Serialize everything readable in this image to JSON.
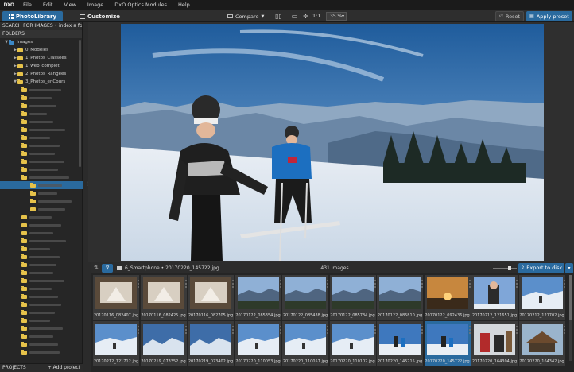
{
  "menubar": {
    "logo": "DXO",
    "items": [
      "File",
      "Edit",
      "View",
      "Image",
      "DxO Optics Modules",
      "Help"
    ]
  },
  "toolbar": {
    "photolibrary_label": "PhotoLibrary",
    "customize_label": "Customize",
    "compare_label": "Compare",
    "one_to_one": "1:1",
    "zoom_value": "35 %",
    "reset_label": "Reset",
    "apply_preset_label": "Apply preset"
  },
  "left_panel": {
    "search_label": "SEARCH FOR IMAGES • index a folder",
    "folders_header": "FOLDERS",
    "tree": [
      {
        "label": "Images",
        "indent": 1,
        "drive": true,
        "open": true
      },
      {
        "label": "0_Modeles",
        "indent": 2,
        "open": false
      },
      {
        "label": "1_Photos_Classees",
        "indent": 2,
        "open": false
      },
      {
        "label": "1_web_complet",
        "indent": 2,
        "open": false
      },
      {
        "label": "2_Photos_Rangees",
        "indent": 2,
        "open": false
      },
      {
        "label": "3_Photos_enCours",
        "indent": 2,
        "open": true
      }
    ],
    "projects_label": "PROJECTS",
    "add_project_label": "+ Add project"
  },
  "filmstrip_bar": {
    "breadcrumb": "6_Smartphone • 20170220_145722.jpg",
    "count": "431 images",
    "export_label": "Export to disk"
  },
  "filmstrip": {
    "selected_index": 17,
    "thumbnails": [
      {
        "name": "20170116_082407.jpg",
        "scene": "indoor"
      },
      {
        "name": "20170116_082425.jpg",
        "scene": "indoor"
      },
      {
        "name": "20170116_082705.jpg",
        "scene": "indoor"
      },
      {
        "name": "20170122_085354.jpg",
        "scene": "valley"
      },
      {
        "name": "20170122_085438.jpg",
        "scene": "valley"
      },
      {
        "name": "20170122_085734.jpg",
        "scene": "valley"
      },
      {
        "name": "20170122_085810.jpg",
        "scene": "valley"
      },
      {
        "name": "20170122_092436.jpg",
        "scene": "sunset"
      },
      {
        "name": "20170212_121651.jpg",
        "scene": "portrait"
      },
      {
        "name": "20170212_121702.jpg",
        "scene": "snow"
      },
      {
        "name": "20170212_121712.jpg",
        "scene": "snow"
      },
      {
        "name": "20170219_073352.jpg",
        "scene": "mountain"
      },
      {
        "name": "20170219_073402.jpg",
        "scene": "mountain"
      },
      {
        "name": "20170220_110053.jpg",
        "scene": "snow"
      },
      {
        "name": "20170220_110057.jpg",
        "scene": "snow"
      },
      {
        "name": "20170220_110102.jpg",
        "scene": "snow"
      },
      {
        "name": "20170220_145715.jpg",
        "scene": "skiers"
      },
      {
        "name": "20170220_145722.jpg",
        "scene": "skiers"
      },
      {
        "name": "20170220_164304.jpg",
        "scene": "people"
      },
      {
        "name": "20170220_164342.jpg",
        "scene": "lodge"
      }
    ]
  },
  "colors": {
    "accent": "#2a6a9e",
    "folder": "#e6c24a",
    "drive": "#3c88c6"
  }
}
